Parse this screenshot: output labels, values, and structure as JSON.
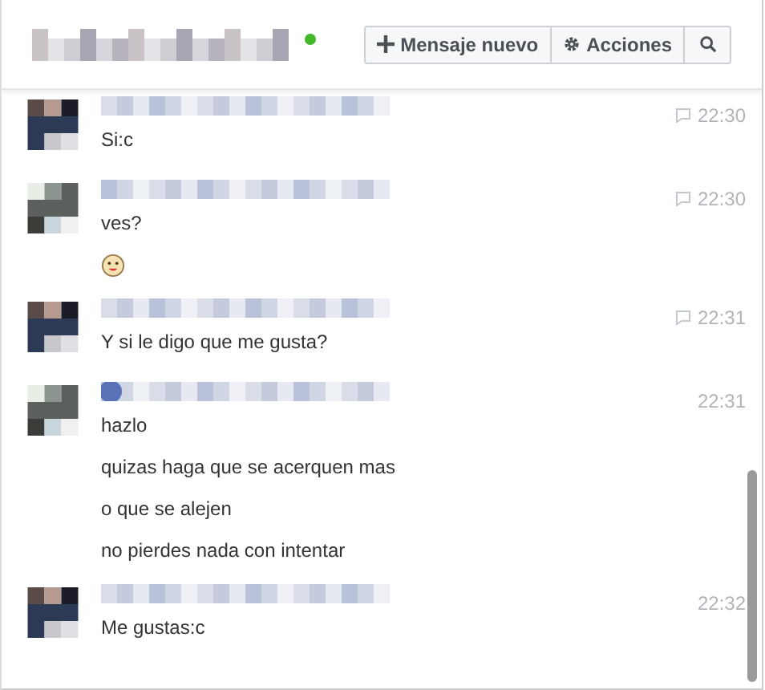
{
  "header": {
    "online": true,
    "buttons": [
      {
        "kind": "new",
        "label": "Mensaje nuevo"
      },
      {
        "kind": "actions",
        "label": "Acciones"
      },
      {
        "kind": "search"
      }
    ]
  },
  "messages": [
    {
      "time": "22:30",
      "reply_icon": true,
      "lines": [
        {
          "kind": "text",
          "text": "Si:c"
        }
      ]
    },
    {
      "time": "22:30",
      "reply_icon": true,
      "lines": [
        {
          "kind": "text",
          "text": "ves?"
        },
        {
          "kind": "emoji"
        }
      ]
    },
    {
      "time": "22:31",
      "reply_icon": true,
      "lines": [
        {
          "kind": "text",
          "text": "Y si le digo que me gusta?"
        }
      ]
    },
    {
      "time": "22:31",
      "reply_icon": false,
      "lines": [
        {
          "kind": "text",
          "text": "hazlo"
        },
        {
          "kind": "text",
          "text": "quizas haga que se acerquen mas"
        },
        {
          "kind": "text",
          "text": "o que se alejen"
        },
        {
          "kind": "text",
          "text": "no pierdes nada con intentar"
        }
      ]
    },
    {
      "time": "22:32",
      "reply_icon": false,
      "lines": [
        {
          "kind": "text",
          "text": "Me gustas:c"
        }
      ]
    }
  ]
}
